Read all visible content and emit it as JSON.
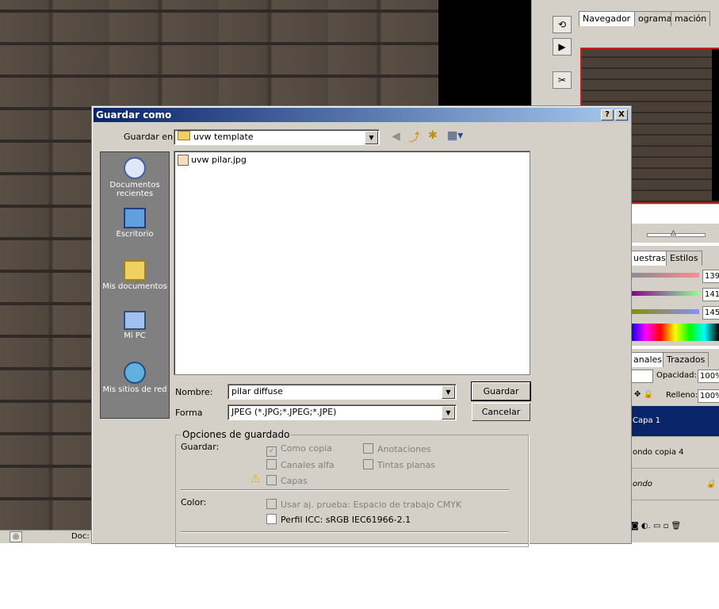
{
  "photoshop": {
    "status_doc": "Doc:",
    "panel_tabs": [
      "Navegador ×",
      "ograma",
      "mación"
    ],
    "color_tabs": [
      "uestras",
      "Estilos"
    ],
    "rgb_values": [
      "139",
      "141",
      "145"
    ],
    "layer_tabs": [
      "anales",
      "Trazados"
    ],
    "opacity_label": "Opacidad:",
    "opacity_value": "100%",
    "fill_label": "Relleno:",
    "fill_value": "100%",
    "layers": [
      "Capa 1",
      "ondo copia 4",
      "ondo"
    ]
  },
  "dialog": {
    "title": "Guardar como",
    "help_btn": "?",
    "close_btn": "X",
    "save_in_label": "Guardar en:",
    "save_in_value": "uvw template",
    "places": [
      "Documentos recientes",
      "Escritorio",
      "Mis documentos",
      "Mi PC",
      "Mis sitios de red"
    ],
    "files": [
      "uvw pilar.jpg"
    ],
    "name_label": "Nombre:",
    "name_value": "pilar diffuse",
    "format_label": "Forma",
    "format_value": "JPEG (*.JPG;*.JPEG;*.JPE)",
    "save_button": "Guardar",
    "cancel_button": "Cancelar",
    "options": {
      "legend": "Opciones de guardado",
      "save_label": "Guardar:",
      "as_copy": "Como copia",
      "annotations": "Anotaciones",
      "alpha_channels": "Canales alfa",
      "spot_colors": "Tintas planas",
      "layers": "Capas",
      "color_label": "Color:",
      "use_proof": "Usar aj. prueba: Espacio de trabajo CMYK",
      "icc_profile": "Perfil ICC: sRGB IEC61966-2.1"
    }
  }
}
